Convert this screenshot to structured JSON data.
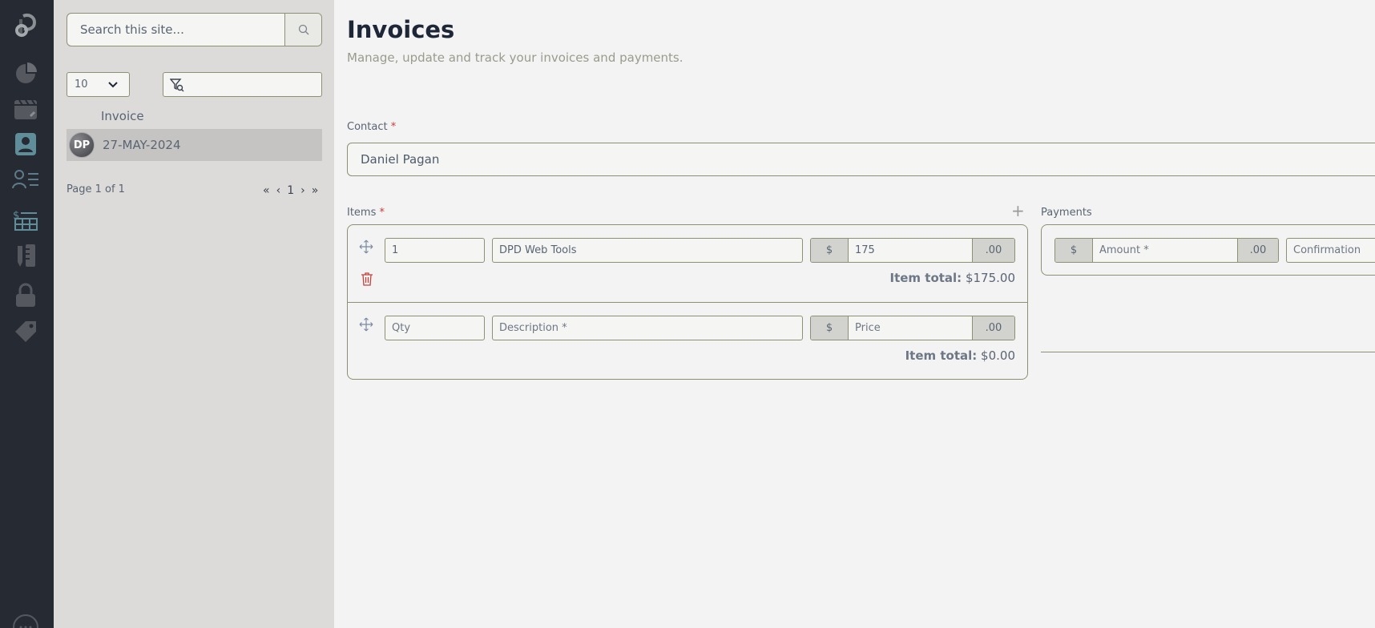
{
  "sidebar": {
    "icons": [
      "logo-icon",
      "pie-chart-icon",
      "calendar-edit-icon",
      "user-icon",
      "user-list-icon",
      "invoice-table-icon",
      "ruler-pencil-icon",
      "lock-icon",
      "tag-icon",
      "more-icon"
    ]
  },
  "panel": {
    "search_placeholder": "Search this site...",
    "page_size": "10",
    "column_header": "Invoice",
    "rows": [
      {
        "initials": "DP",
        "date": "27-MAY-2024"
      }
    ],
    "page_info": "Page 1 of 1",
    "pager": {
      "first": "«",
      "prev": "‹",
      "current": "1",
      "next": "›",
      "last": "»"
    }
  },
  "main": {
    "title": "Invoices",
    "subtitle": "Manage, update and track your invoices and payments.",
    "contact_label": "Contact",
    "required_mark": "*",
    "contact_value": "Daniel Pagan",
    "items_label": "Items",
    "add_symbol": "+",
    "items": [
      {
        "qty": "1",
        "description": "DPD Web Tools",
        "currency": "$",
        "price": "175",
        "cents": ".00",
        "total_label": "Item total:",
        "total": "$175.00"
      },
      {
        "qty": "Qty",
        "description": "Description *",
        "currency": "$",
        "price": "Price",
        "cents": ".00",
        "total_label": "Item total:",
        "total": "$0.00"
      }
    ],
    "payments_label": "Payments",
    "payment": {
      "currency": "$",
      "amount": "Amount *",
      "cents": ".00",
      "confirmation": "Confirmation"
    }
  },
  "colors": {
    "rail": "#262a33",
    "panel": "#dcdbd9",
    "main": "#f3f3f3",
    "border": "#8f8f73",
    "accent": "#5f8e9a",
    "required": "#c2413d"
  }
}
